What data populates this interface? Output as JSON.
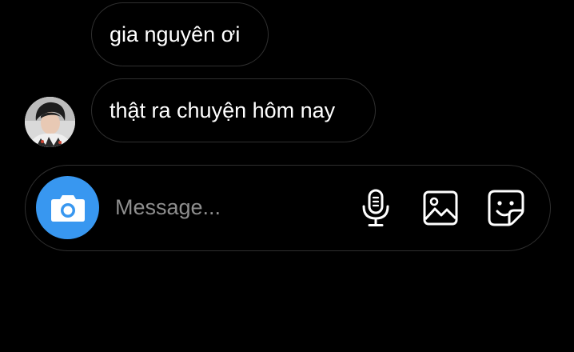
{
  "messages": [
    {
      "text": "gia nguyên ơi"
    },
    {
      "text": "thật ra chuyện hôm nay"
    }
  ],
  "composer": {
    "placeholder": "Message..."
  },
  "colors": {
    "background": "#000000",
    "bubble_border": "#2f2f2f",
    "camera_button": "#3897f0",
    "placeholder": "#8e8e8e",
    "text": "#ffffff"
  },
  "icons": {
    "camera": "camera-icon",
    "microphone": "microphone-icon",
    "gallery": "gallery-icon",
    "sticker": "sticker-icon"
  }
}
